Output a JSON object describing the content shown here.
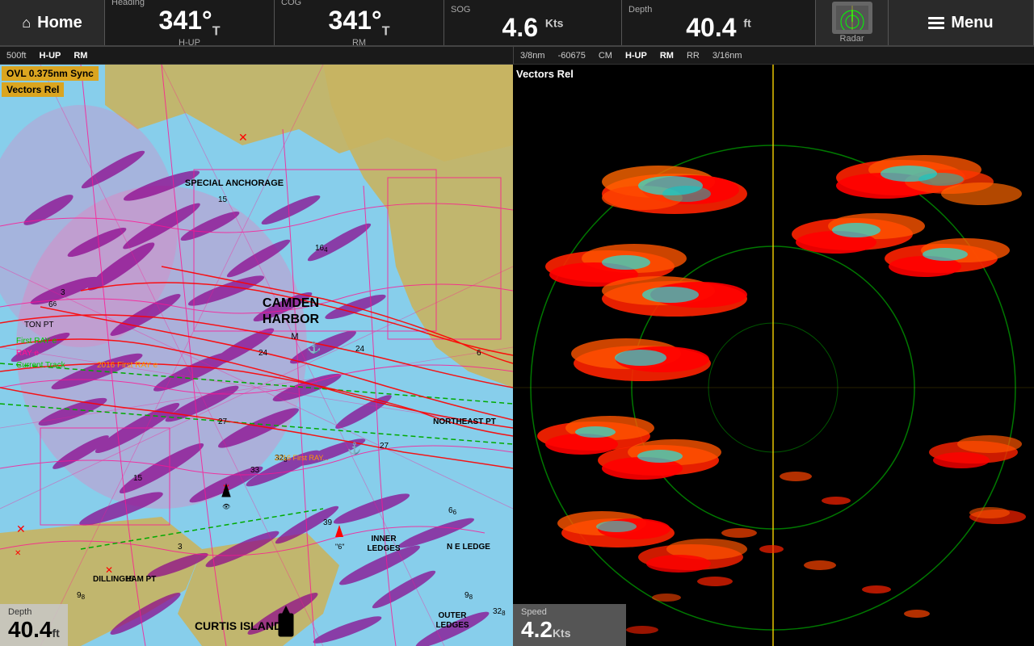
{
  "topbar": {
    "home_label": "Home",
    "heading_label": "Heading",
    "heading_value": "341°",
    "heading_sub": "T",
    "heading_sublabel": "H-UP",
    "cog_label": "COG",
    "cog_value": "341°",
    "cog_sub": "T",
    "cog_sublabel": "RM",
    "sog_label": "SOG",
    "sog_value": "4.6",
    "sog_unit": "Kts",
    "depth_label": "Depth",
    "depth_value": "40.4",
    "depth_unit": "ft",
    "radar_label": "Radar",
    "menu_label": "Menu"
  },
  "subbar": {
    "left": {
      "scale": "500ft",
      "orient": "H-UP",
      "mode": "RM"
    },
    "right": {
      "scale1": "3/8nm",
      "code": "-60675",
      "cm": "CM",
      "orient": "H-UP",
      "mode": "RM",
      "rr": "RR",
      "scale2": "3/16nm"
    }
  },
  "chart": {
    "ovl_label": "OVL 0.375nm Sync",
    "vectors_label": "Vectors Rel",
    "place_names": [
      "SPECIAL ANCHORAGE",
      "CAMDEN HARBOR",
      "NORTHEAST PT",
      "INNER LEDGES",
      "N E LEDGE",
      "OUTER LEDGES",
      "DILLINGHAM PT",
      "CURTIS ISLAND",
      "TON PT"
    ],
    "depth_label": "Depth",
    "depth_value": "40.4",
    "depth_unit": "ft",
    "route_labels": [
      "2016 First RAY e",
      "2016 First RAY e",
      "2016 First RAY e"
    ],
    "ray_labels": [
      "First RAY e",
      "RAY e",
      "Current Track"
    ]
  },
  "radar": {
    "vectors_label": "Vectors Rel",
    "speed_label": "Speed",
    "speed_value": "4.2",
    "speed_unit": "Kts"
  }
}
